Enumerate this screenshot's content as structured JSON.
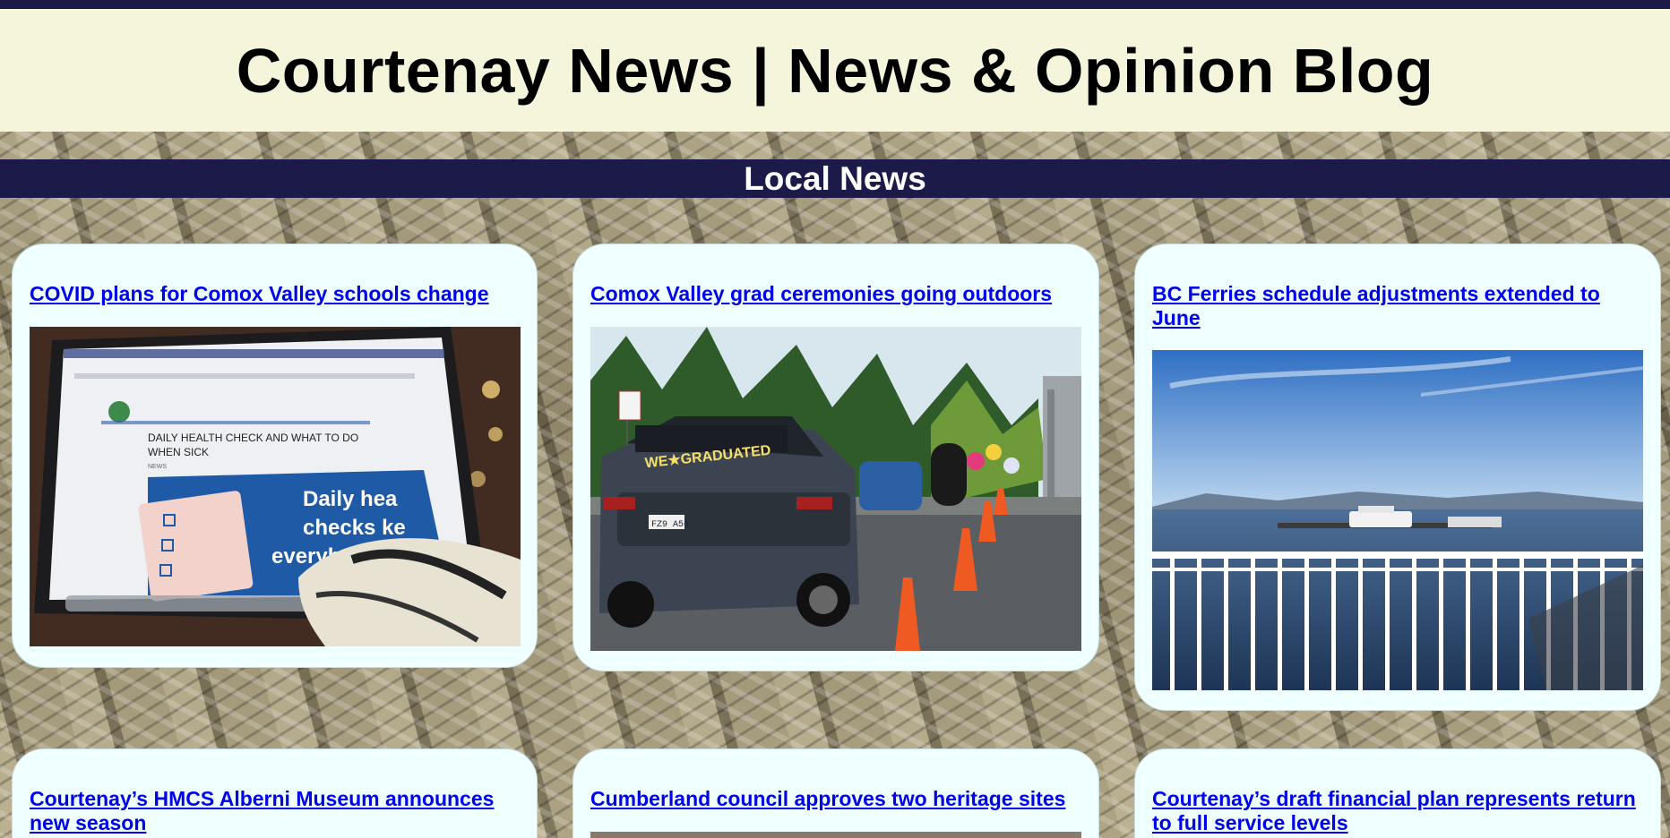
{
  "site": {
    "title": "Courtenay News | News & Opinion Blog"
  },
  "section": {
    "title": "Local News"
  },
  "articles": [
    {
      "title": "COVID plans for Comox Valley schools change",
      "image": "laptop-health-check-photo"
    },
    {
      "title": "Comox Valley grad ceremonies going outdoors",
      "image": "grad-car-parade-photo"
    },
    {
      "title": "BC Ferries schedule adjustments extended to June",
      "image": "ferry-terminal-photo"
    },
    {
      "title": "Courtenay’s HMCS Alberni Museum announces new season",
      "image": ""
    },
    {
      "title": "Cumberland council approves two heritage sites",
      "image": ""
    },
    {
      "title": "Courtenay’s draft financial plan represents return to full service levels",
      "image": ""
    }
  ],
  "photo_text": {
    "laptop_heading": "DAILY HEALTH CHECK AND WHAT TO DO WHEN SICK",
    "laptop_tag": "NEWS",
    "laptop_banner": "Daily hea checks ke everybody s",
    "car_sign": "WE★GRADUATED",
    "car_plate": "FZ9 A56"
  },
  "colors": {
    "header_bg": "#f5f5dc",
    "nav_bar": "#1b1a48",
    "card_bg": "#f0ffff",
    "link": "#0000ee"
  }
}
